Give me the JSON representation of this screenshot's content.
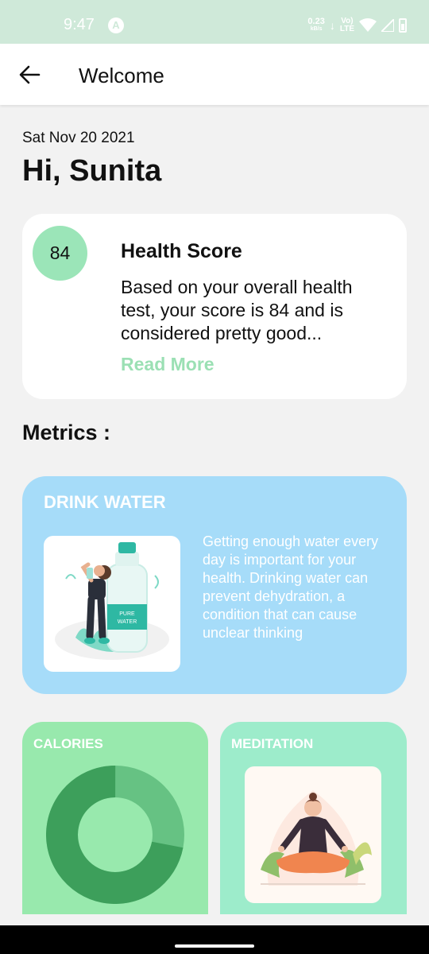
{
  "status_bar": {
    "time": "9:47",
    "app_icon_letter": "A",
    "net_speed": "0.23",
    "net_unit": "kB/s",
    "volte_top": "Vo)",
    "volte_bottom": "LTE"
  },
  "app_bar": {
    "title": "Welcome"
  },
  "header": {
    "date": "Sat Nov 20 2021",
    "greeting": "Hi, Sunita"
  },
  "health_score": {
    "score": "84",
    "title": "Health Score",
    "description": "Based on your overall health test, your score is 84 and is considered pretty good...",
    "link": "Read More"
  },
  "metrics": {
    "heading": "Metrics :",
    "water": {
      "title": "DRINK WATER",
      "description": "Getting enough water every day is important for your health. Drinking water can prevent dehydration, a condition that can cause unclear thinking",
      "bottle_label_top": "PURE",
      "bottle_label_bottom": "WATER"
    },
    "calories": {
      "title": "CALORIES",
      "chart_fraction": 0.72
    },
    "meditation": {
      "title": "MEDITATION"
    }
  },
  "colors": {
    "status_bar": "#cfe9d9",
    "accent_green": "#9be5b8",
    "water_card": "#a6dcf9",
    "calories_card": "#98e9ad",
    "meditation_card": "#9deccb",
    "donut_dark": "#3d9f5b",
    "donut_light": "#66c283"
  }
}
